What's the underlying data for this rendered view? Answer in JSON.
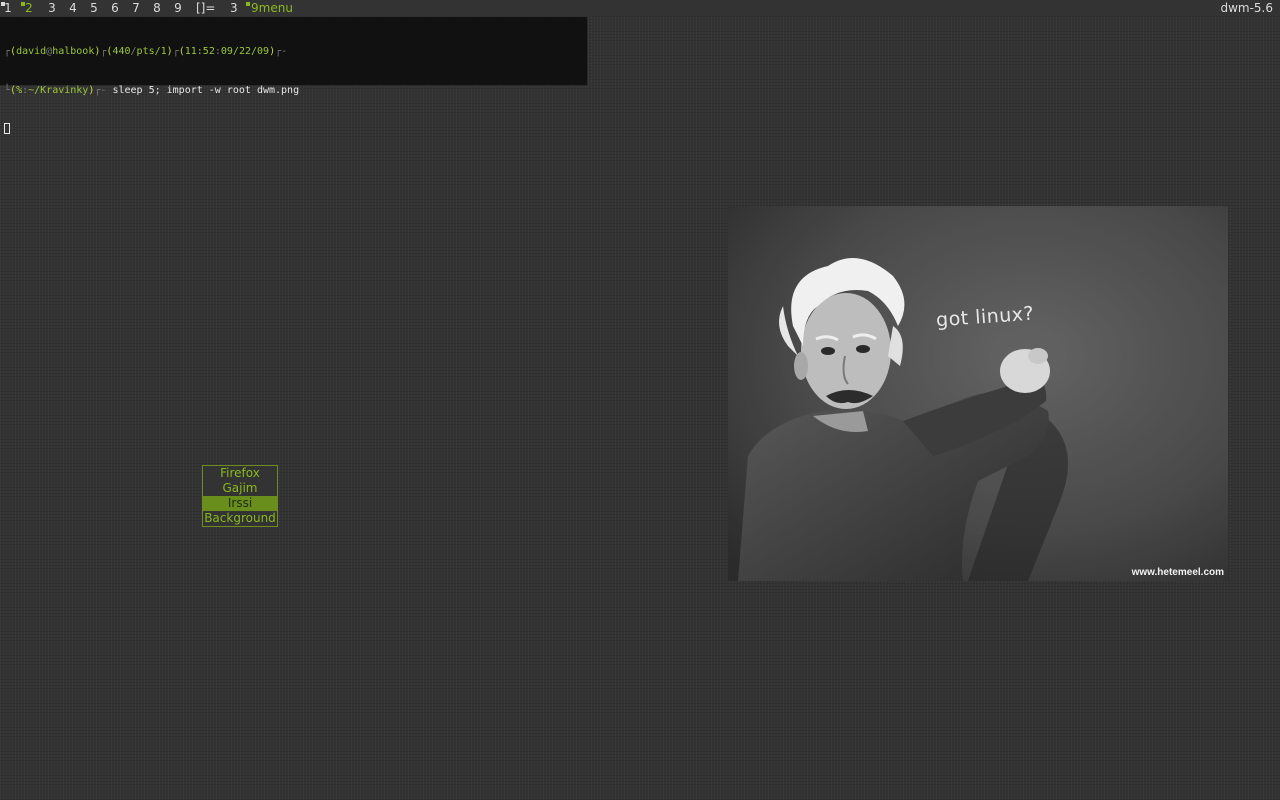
{
  "bar": {
    "tags": [
      {
        "label": "1",
        "occupied": true,
        "selected": false
      },
      {
        "label": "2",
        "occupied": true,
        "selected": true
      },
      {
        "label": "3",
        "occupied": false,
        "selected": false
      },
      {
        "label": "4",
        "occupied": false,
        "selected": false
      },
      {
        "label": "5",
        "occupied": false,
        "selected": false
      },
      {
        "label": "6",
        "occupied": false,
        "selected": false
      },
      {
        "label": "7",
        "occupied": false,
        "selected": false
      },
      {
        "label": "8",
        "occupied": false,
        "selected": false
      },
      {
        "label": "9",
        "occupied": false,
        "selected": false
      }
    ],
    "layout_symbol": "[]=",
    "client_count": "3",
    "window_title": "9menu",
    "status_text": "dwm-5.6",
    "accent_color": "#8bb81e"
  },
  "terminal": {
    "prompt_line1": {
      "user": "david",
      "at": "@",
      "host": "halbook",
      "history": "440",
      "tty": "pts/1",
      "time": "11:52",
      "date": "09/22/09"
    },
    "prompt_line2": {
      "exit": "%",
      "cwd": "~/Kravinky",
      "command": "sleep 5; import -w root dwm.png"
    }
  },
  "menu": {
    "items": [
      {
        "label": "Firefox",
        "active": false
      },
      {
        "label": "Gajim",
        "active": false
      },
      {
        "label": "Irssi",
        "active": true
      },
      {
        "label": "Background",
        "active": false
      }
    ]
  },
  "wallpaper": {
    "chalk_text": "got linux?",
    "credit": "www.hetemeel.com"
  }
}
